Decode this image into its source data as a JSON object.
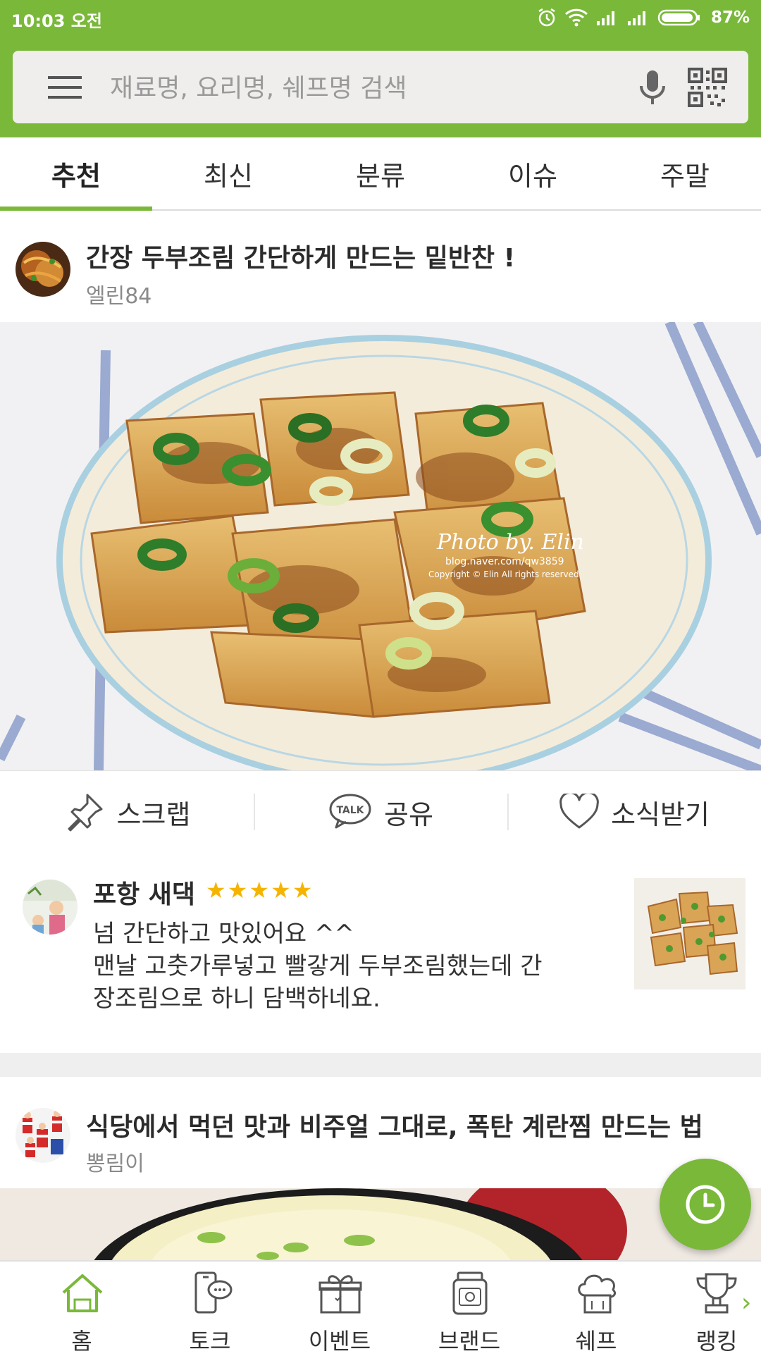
{
  "status_bar": {
    "time": "10:03 오전",
    "battery": "87%"
  },
  "search": {
    "placeholder": "재료명, 요리명, 쉐프명 검색",
    "value": ""
  },
  "tabs": [
    {
      "label": "추천",
      "active": true
    },
    {
      "label": "최신",
      "active": false
    },
    {
      "label": "분류",
      "active": false
    },
    {
      "label": "이슈",
      "active": false
    },
    {
      "label": "주말",
      "active": false
    }
  ],
  "posts": [
    {
      "title": "간장 두부조림 간단하게 만드는 밑반찬 !",
      "author": "엘린84",
      "photo_watermark": [
        "Photo by. Elin",
        "blog.naver.com/qw3859",
        "Copyright © Elin All rights reserved"
      ],
      "actions": {
        "scrap": "스크랩",
        "share": "공유",
        "follow": "소식받기",
        "talk_badge": "TALK"
      },
      "review": {
        "name": "포항 새댁",
        "rating": 5,
        "stars": "★★★★★",
        "lines": [
          "넘 간단하고 맛있어요 ^^",
          "맨날 고춧가루넣고 빨갛게 두부조림했는데 간",
          "장조림으로 하니 담백하네요."
        ]
      }
    },
    {
      "title": "식당에서 먹던 맛과 비주얼 그대로, 폭탄 계란찜 만드는 법",
      "author": "뽕림이"
    }
  ],
  "bottom_nav": [
    {
      "label": "홈",
      "icon": "home-icon",
      "active": true
    },
    {
      "label": "토크",
      "icon": "phone-chat-icon",
      "active": false
    },
    {
      "label": "이벤트",
      "icon": "gift-icon",
      "active": false
    },
    {
      "label": "브랜드",
      "icon": "jar-icon",
      "active": false
    },
    {
      "label": "쉐프",
      "icon": "chef-hat-icon",
      "active": false
    },
    {
      "label": "랭킹",
      "icon": "trophy-icon",
      "active": false
    }
  ],
  "colors": {
    "brand_green": "#7ab83a",
    "star_yellow": "#f5b400"
  }
}
